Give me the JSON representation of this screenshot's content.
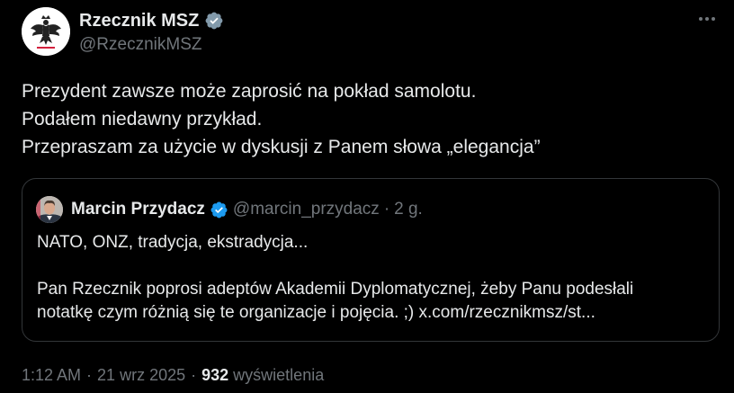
{
  "author": {
    "display_name": "Rzecznik MSZ",
    "handle": "@RzecznikMSZ",
    "verified_icon": "verified-badge-icon",
    "avatar": "polish-eagle-emblem"
  },
  "tweet": {
    "lines": [
      "Prezydent zawsze może zaprosić na pokład samolotu.",
      "Podałem niedawny przykład.",
      "Przepraszam za użycie w dyskusji z Panem słowa „elegancja”"
    ]
  },
  "quoted": {
    "display_name": "Marcin Przydacz",
    "handle": "@marcin_przydacz",
    "separator": "·",
    "time": "2 g.",
    "line1": "NATO, ONZ, tradycja, ekstradycja...",
    "paragraph_line1": "Pan Rzecznik poprosi adeptów Akademii Dyplomatycznej, żeby Panu podesłali",
    "paragraph_line2": "notatkę czym różnią się te organizacje i pojęcia. ;) x.com/rzecznikmsz/st..."
  },
  "meta": {
    "time": "1:12 AM",
    "sep1": "·",
    "date": "21 wrz 2025",
    "sep2": "·",
    "views_count": "932",
    "views_label": "wyświetlenia"
  },
  "colors": {
    "background": "#000000",
    "text_primary": "#e7e9ea",
    "text_secondary": "#71767b",
    "verified_blue": "#1d9bf0",
    "border": "#333639"
  }
}
